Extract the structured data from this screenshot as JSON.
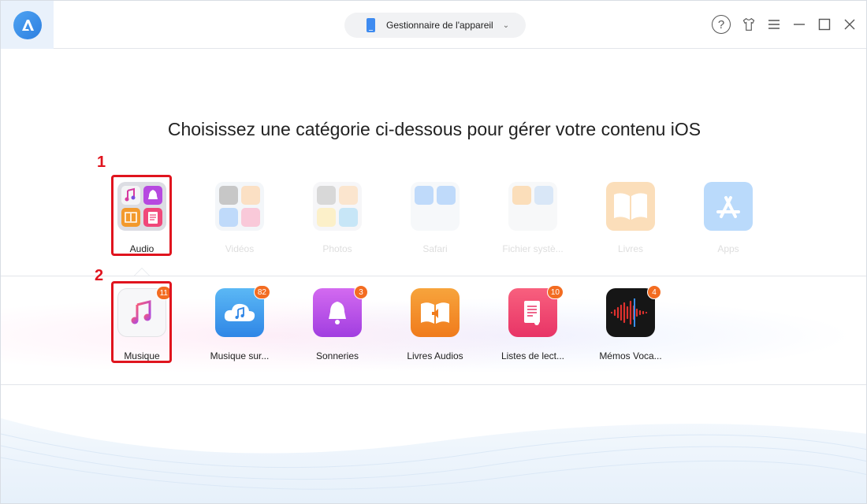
{
  "titlebar": {
    "device_selector_label": "Gestionnaire de l'appareil",
    "icons": [
      "app-logo",
      "phone-icon",
      "chevron-down-icon",
      "help-icon",
      "skin-shirt-icon",
      "menu-icon",
      "minimize-icon",
      "maximize-icon",
      "close-icon"
    ]
  },
  "main": {
    "heading": "Choisissez une catégorie ci-dessous pour gérer votre contenu iOS",
    "categories": [
      {
        "label": "Audio",
        "active": true
      },
      {
        "label": "Vidéos",
        "active": false
      },
      {
        "label": "Photos",
        "active": false
      },
      {
        "label": "Safari",
        "active": false
      },
      {
        "label": "Fichier systè...",
        "active": false
      },
      {
        "label": "Livres",
        "active": false
      },
      {
        "label": "Apps",
        "active": false
      }
    ],
    "subcategories": [
      {
        "label": "Musique",
        "count": "11"
      },
      {
        "label": "Musique sur...",
        "count": "82"
      },
      {
        "label": "Sonneries",
        "count": "3"
      },
      {
        "label": "Livres Audios",
        "count": ""
      },
      {
        "label": "Listes de lect...",
        "count": "10"
      },
      {
        "label": "Mémos Voca...",
        "count": "4"
      }
    ]
  },
  "annotations": {
    "step1": "1",
    "step2": "2"
  },
  "colors": {
    "accent": "#3e8bf0",
    "badge": "#f36c21",
    "annotation": "#e0141e"
  }
}
